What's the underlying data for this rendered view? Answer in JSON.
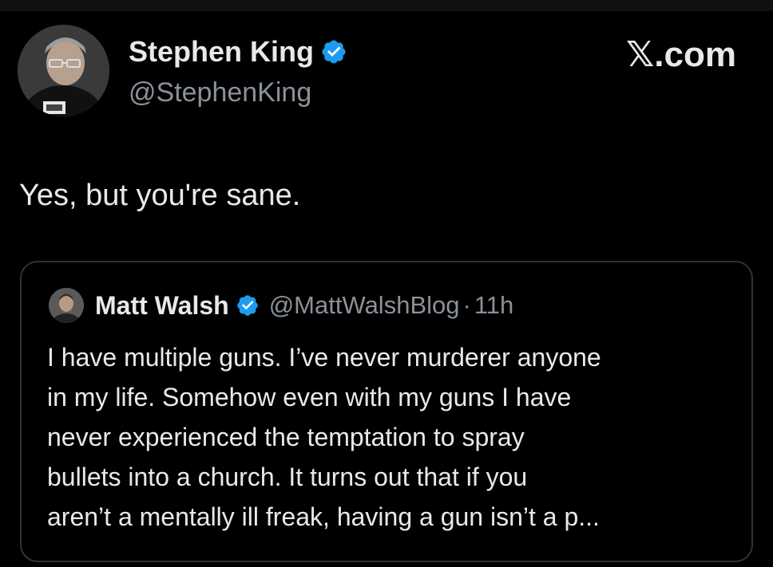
{
  "tweet": {
    "author": {
      "name": "Stephen King",
      "handle": "@StephenKing",
      "verified": true,
      "avatar_icon": "user-photo-avatar"
    },
    "text": "Yes, but you're sane."
  },
  "site_logo": "𝕏.com",
  "quoted_tweet": {
    "author": {
      "name": "Matt Walsh",
      "handle": "@MattWalshBlog",
      "verified": true,
      "avatar_icon": "user-photo-avatar"
    },
    "separator": "·",
    "time": "11h",
    "text_lines": [
      "I have multiple guns. I’ve never murderer anyone",
      "in my life. Somehow even with my guns I have",
      "never experienced the temptation to spray",
      "bullets into a church. It turns out that if you",
      "aren’t a mentally ill freak, having a gun isn’t a p..."
    ]
  },
  "colors": {
    "background": "#000000",
    "text": "#e7e9ea",
    "muted": "#8b9199",
    "verified": "#1d9bf0",
    "border": "#2f3336"
  }
}
